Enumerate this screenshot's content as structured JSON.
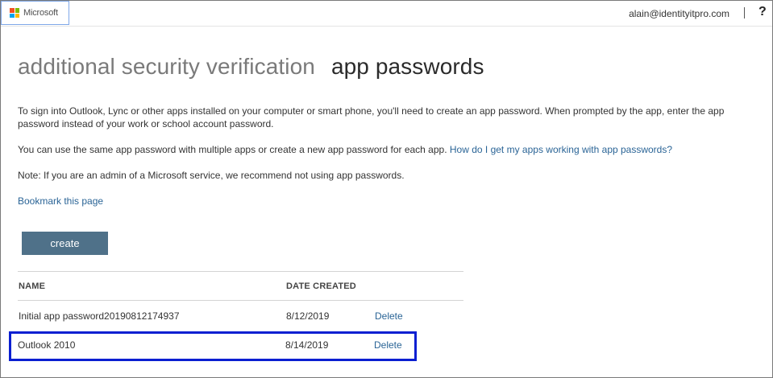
{
  "header": {
    "logo_text": "Microsoft",
    "logo_colors": [
      "#f25022",
      "#7fba00",
      "#00a4ef",
      "#ffb900"
    ],
    "user_email": "alain@identityitpro.com",
    "help_label": "?"
  },
  "title": {
    "inactive_tab": "additional security verification",
    "active_tab": "app passwords"
  },
  "intro": {
    "line1": "To sign into Outlook, Lync or other apps installed on your computer or smart phone, you'll need to create an app password. When prompted by the app, enter the app password instead of your work or school account password.",
    "line2_text": "You can use the same app password with multiple apps or create a new app password for each app.",
    "line2_link": "How do I get my apps working with app passwords?",
    "note": "Note: If you are an admin of a Microsoft service, we recommend not using app passwords.",
    "bookmark": "Bookmark this page"
  },
  "create_button": "create",
  "table": {
    "headers": {
      "name": "NAME",
      "date": "DATE CREATED"
    },
    "rows": [
      {
        "name": "Initial app password20190812174937",
        "date": "8/12/2019",
        "action": "Delete"
      },
      {
        "name": "Outlook 2010",
        "date": "8/14/2019",
        "action": "Delete"
      }
    ]
  },
  "colors": {
    "button": "#4f7189",
    "link": "#2a6496",
    "highlight_border": "#0a1fd1"
  }
}
